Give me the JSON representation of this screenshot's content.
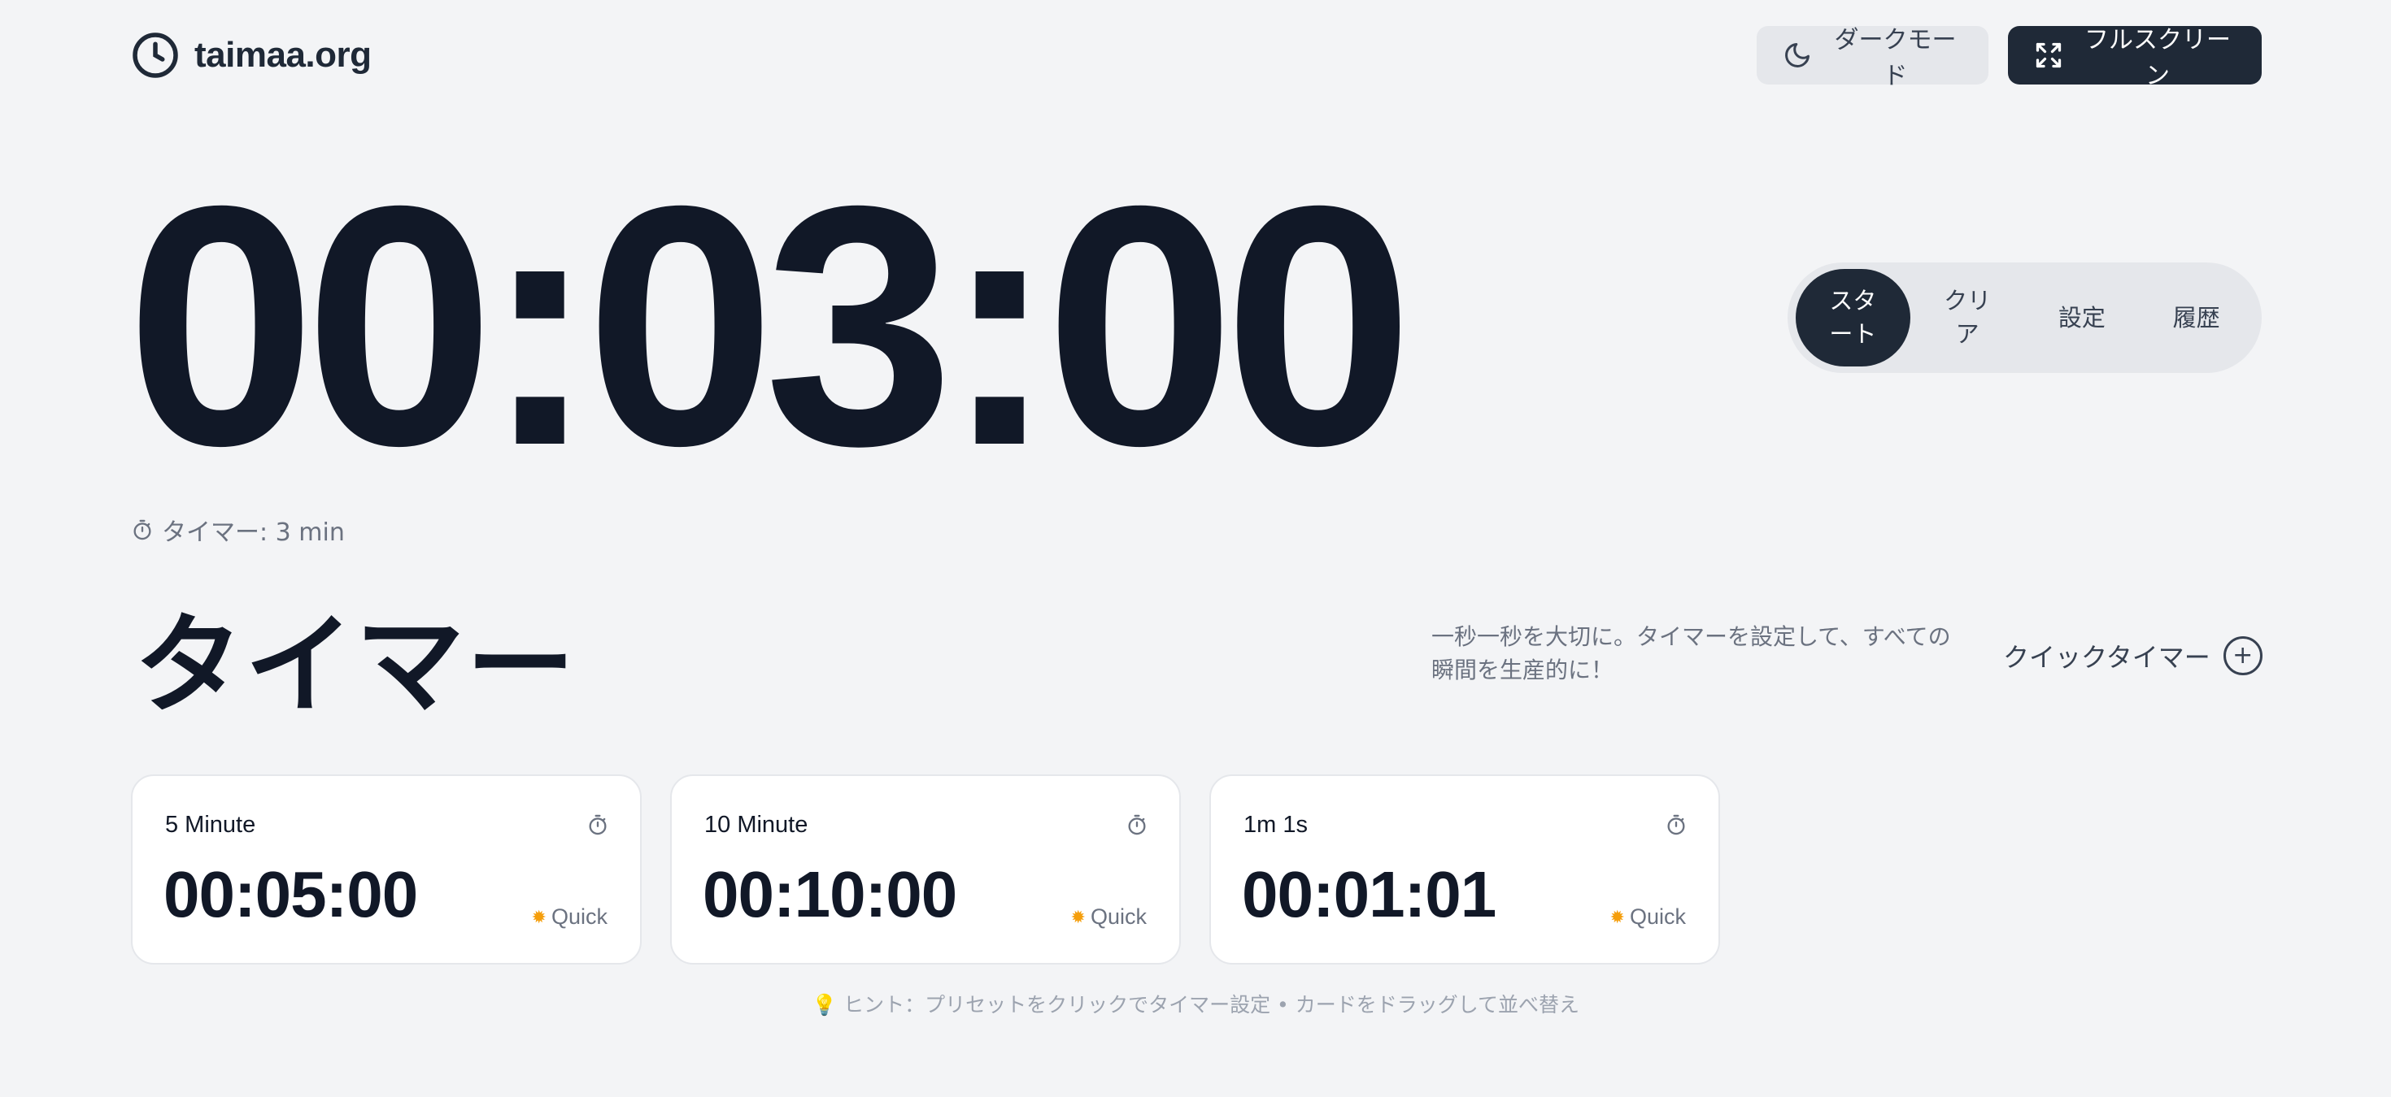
{
  "header": {
    "brand": "taimaa.org",
    "dark_mode_label": "ダークモード",
    "fullscreen_label": "フルスクリーン"
  },
  "timer": {
    "display": "00:03:00",
    "label": "タイマー: 3 min"
  },
  "controls": {
    "start": "スタート",
    "clear": "クリア",
    "settings": "設定",
    "history": "履歴"
  },
  "section": {
    "title": "タイマー",
    "description": "一秒一秒を大切に。タイマーを設定して、すべての瞬間を生産的に！",
    "quick_timer_label": "クイックタイマー"
  },
  "presets": [
    {
      "name": "5 Minute",
      "time": "00:05:00",
      "badge": "Quick"
    },
    {
      "name": "10 Minute",
      "time": "00:10:00",
      "badge": "Quick"
    },
    {
      "name": "1m 1s",
      "time": "00:01:01",
      "badge": "Quick"
    }
  ],
  "hint": "ヒント：プリセットをクリックでタイマー設定 • カードをドラッグして並べ替え",
  "colors": {
    "background": "#f3f4f6",
    "primary": "#111827",
    "button_dark": "#1f2937",
    "muted": "#6b7280"
  }
}
